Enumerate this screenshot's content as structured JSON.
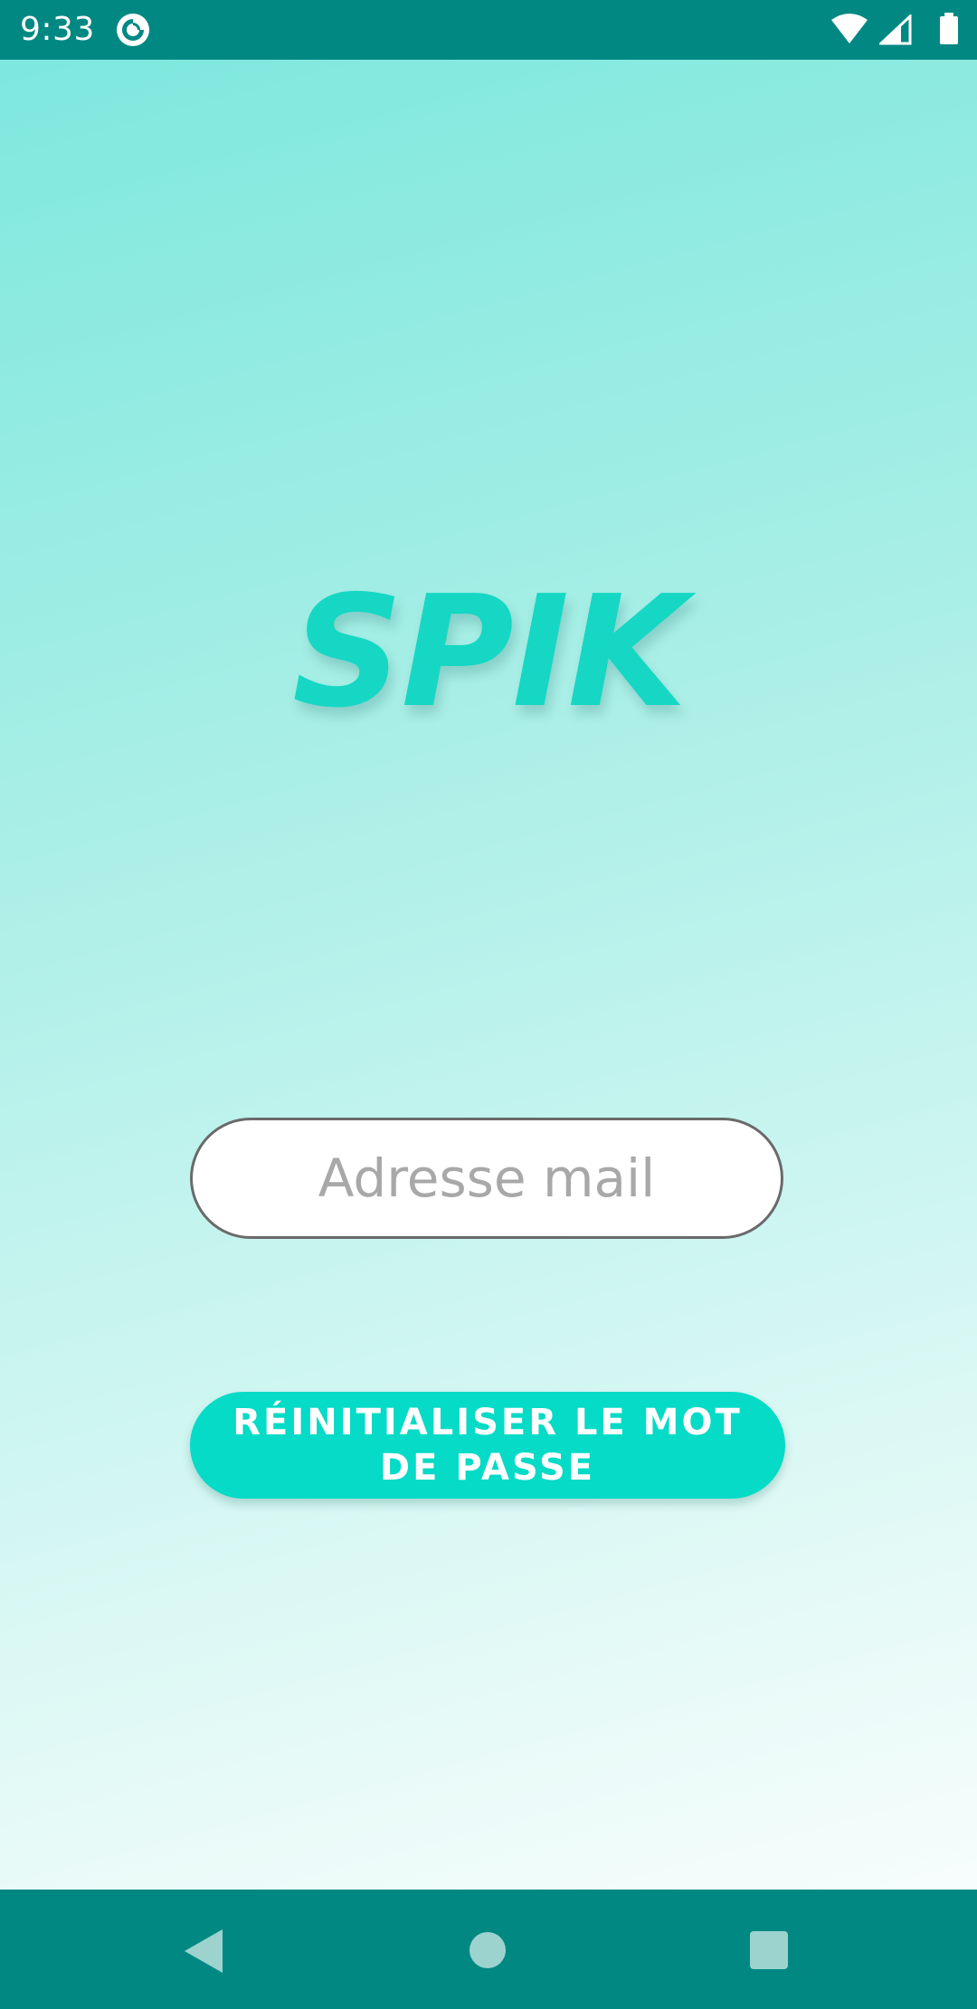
{
  "status_bar": {
    "time": "9:33",
    "app_icon": "pocket-casts-icon",
    "icons": [
      "wifi-icon",
      "cell-signal-icon",
      "battery-icon"
    ],
    "background_color": "#028883"
  },
  "app": {
    "logo_text": "SPIK",
    "logo_color": "#15d7c4"
  },
  "form": {
    "email_placeholder": "Adresse mail",
    "email_value": "",
    "reset_button_label": "RÉINITIALISER  LE MOT DE PASSE",
    "button_color": "#05dbc6"
  },
  "nav_bar": {
    "buttons": [
      "back-icon",
      "home-icon",
      "recents-icon"
    ],
    "background_color": "#028883"
  }
}
